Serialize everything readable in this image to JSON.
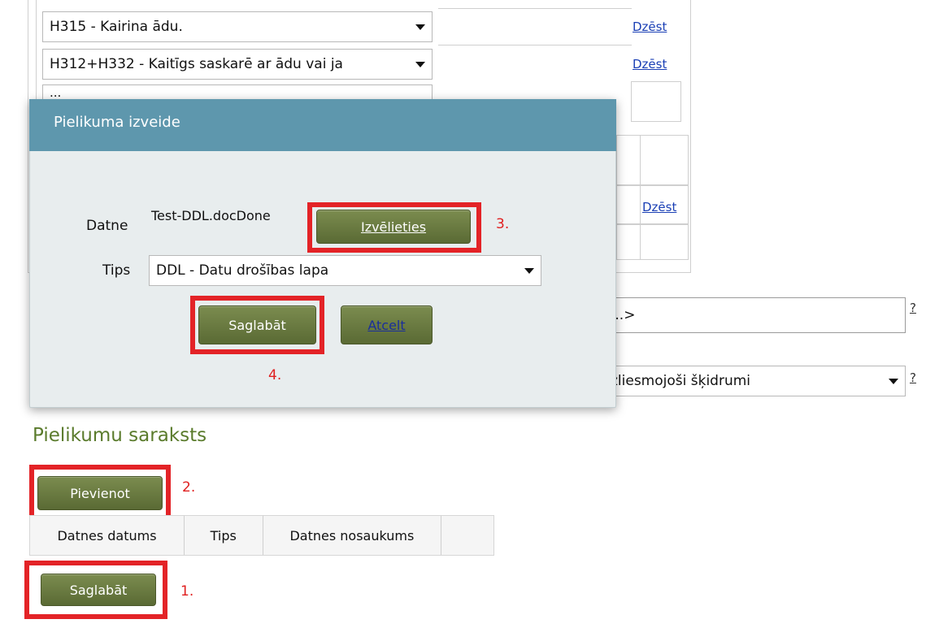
{
  "background": {
    "rows": [
      {
        "select_value": "H315 - Kairina ādu.",
        "delete_label": "Dzēst"
      },
      {
        "select_value": "H312+H332 - Kaitīgs saskarē ar ādu vai ja",
        "delete_label": "Dzēst"
      }
    ],
    "partial_row_text": "...",
    "mid_delete_label": "Dzēst",
    "name_field_value": "...>",
    "category_select_value": "zliesmojoši šķidrumi",
    "help_mark": "?"
  },
  "dialog": {
    "title": "Pielikuma izveide",
    "file_label": "Datne",
    "file_value": "Test-DDL.docDone",
    "choose_button": "Izvēlieties",
    "type_label": "Tips",
    "type_value": "DDL - Datu drošības lapa",
    "save_button": "Saglabāt",
    "cancel_button": "Atcelt"
  },
  "attachments": {
    "title": "Pielikumu saraksts",
    "add_button": "Pievienot",
    "columns": [
      "Datnes datums",
      "Tips",
      "Datnes nosaukums",
      ""
    ]
  },
  "footer": {
    "save_button": "Saglabāt"
  },
  "annotations": {
    "n1": "1.",
    "n2": "2.",
    "n3": "3.",
    "n4": "4."
  },
  "colors": {
    "accent_green": "#5a6a34",
    "dialog_header": "#5e97ad",
    "highlight_red": "#e32327",
    "link_blue": "#1a3fb5"
  }
}
